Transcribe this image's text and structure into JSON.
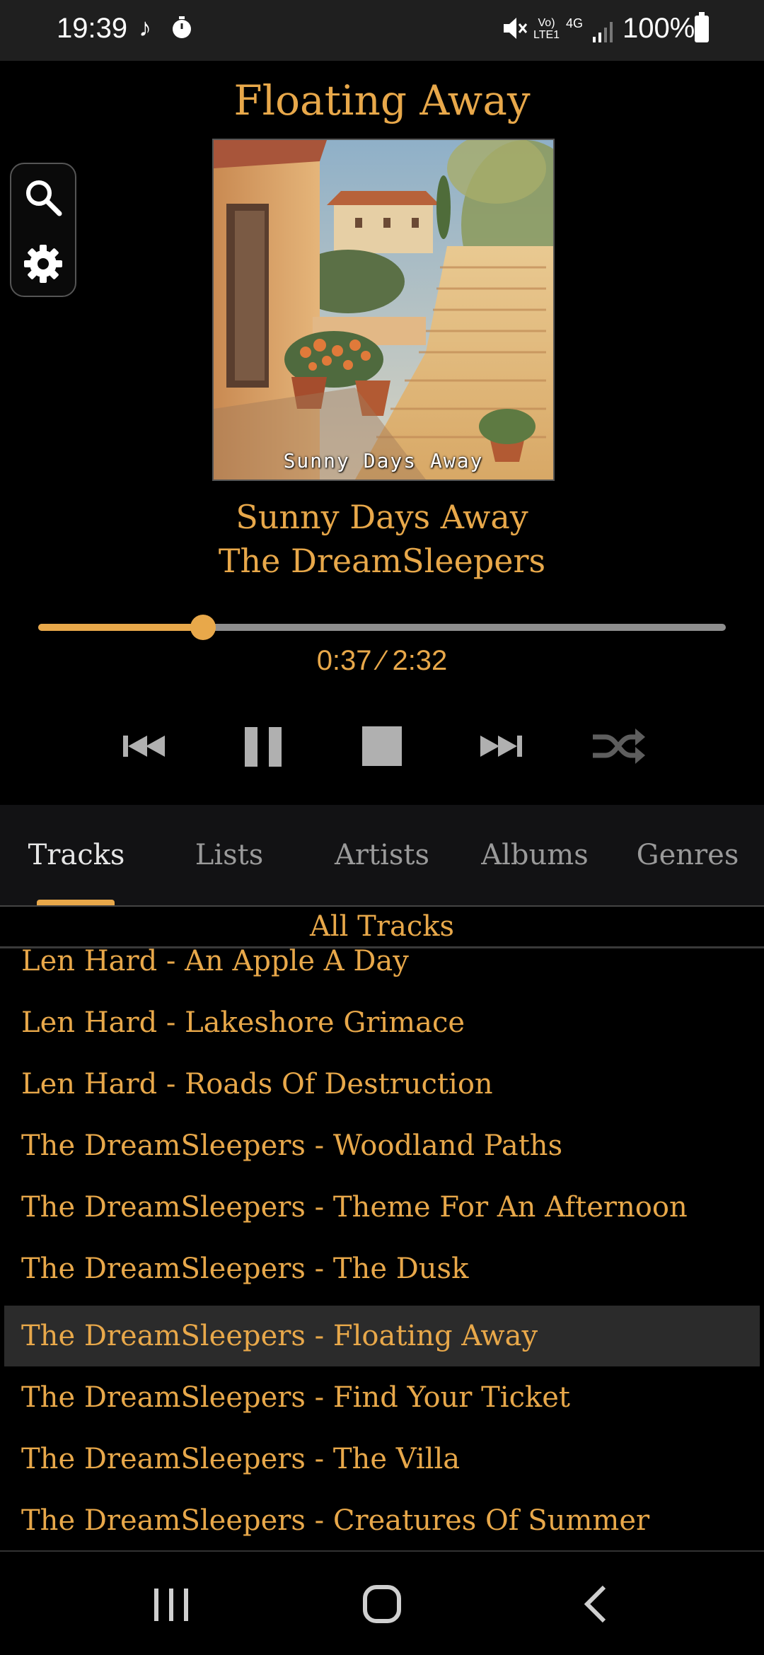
{
  "status_bar": {
    "time": "19:39",
    "note_icon": "music-note-icon",
    "volte_line1": "Vo)",
    "volte_line2": "LTE1",
    "network": "4G",
    "battery": "100%"
  },
  "player": {
    "title": "Floating Away",
    "album_caption": "Sunny Days Away",
    "track_name": "Sunny Days Away",
    "track_artist": "The DreamSleepers",
    "elapsed": "0:37",
    "duration": "2:32",
    "time_readout": "0:37 ⁄ 2:32",
    "progress_fraction": 0.24
  },
  "tools": {
    "search_icon": "search-icon",
    "settings_icon": "gear-icon"
  },
  "controls": {
    "prev_icon": "skip-previous-icon",
    "pause_icon": "pause-icon",
    "stop_icon": "stop-icon",
    "next_icon": "skip-next-icon",
    "shuffle_icon": "shuffle-icon"
  },
  "tabs": [
    {
      "label": "Tracks",
      "active": true
    },
    {
      "label": "Lists",
      "active": false
    },
    {
      "label": "Artists",
      "active": false
    },
    {
      "label": "Albums",
      "active": false
    },
    {
      "label": "Genres",
      "active": false
    }
  ],
  "list": {
    "header": "All Tracks",
    "tracks": [
      {
        "label": "Len Hard - An Apple A Day",
        "selected": false
      },
      {
        "label": "Len Hard - Lakeshore Grimace",
        "selected": false
      },
      {
        "label": "Len Hard - Roads Of Destruction",
        "selected": false
      },
      {
        "label": "The DreamSleepers - Woodland Paths",
        "selected": false
      },
      {
        "label": "The DreamSleepers - Theme For An Afternoon",
        "selected": false
      },
      {
        "label": "The DreamSleepers - The Dusk",
        "selected": false
      },
      {
        "label": "The DreamSleepers - Floating Away",
        "selected": true
      },
      {
        "label": "The DreamSleepers - Find Your Ticket",
        "selected": false
      },
      {
        "label": "The DreamSleepers - The Villa",
        "selected": false
      },
      {
        "label": "The DreamSleepers - Creatures Of Summer",
        "selected": false
      }
    ]
  },
  "colors": {
    "accent": "#e8a84a",
    "background": "#000000",
    "tab_bar": "#121214",
    "selected_row": "#2b2b2b"
  }
}
